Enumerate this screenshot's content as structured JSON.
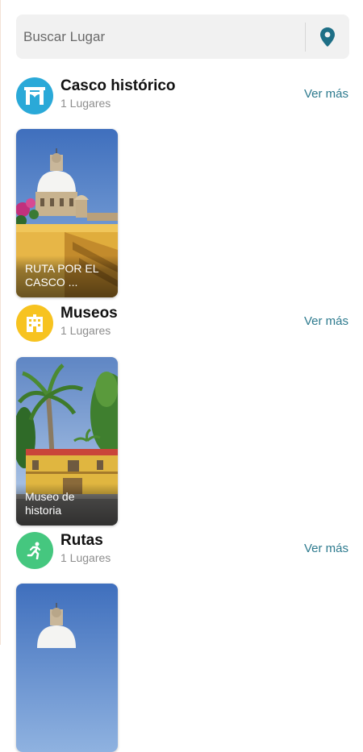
{
  "search": {
    "placeholder": "Buscar Lugar"
  },
  "sections": [
    {
      "title": "Casco histórico",
      "count": "1 Lugares",
      "ver_mas": "Ver más",
      "icon": "archway-icon",
      "icon_color": "#2aa9d8",
      "card": {
        "label": "RUTA POR EL CASCO ..."
      }
    },
    {
      "title": "Museos",
      "count": "1 Lugares",
      "ver_mas": "Ver más",
      "icon": "museum-building-icon",
      "icon_color": "#f7c320",
      "card": {
        "label": "Museo de historia"
      }
    },
    {
      "title": "Rutas",
      "count": "1 Lugares",
      "ver_mas": "Ver más",
      "icon": "running-person-icon",
      "icon_color": "#45c77f",
      "card": {
        "label": ""
      }
    }
  ],
  "colors": {
    "accent_link": "#2d7a8e",
    "pin": "#1e6f86"
  }
}
